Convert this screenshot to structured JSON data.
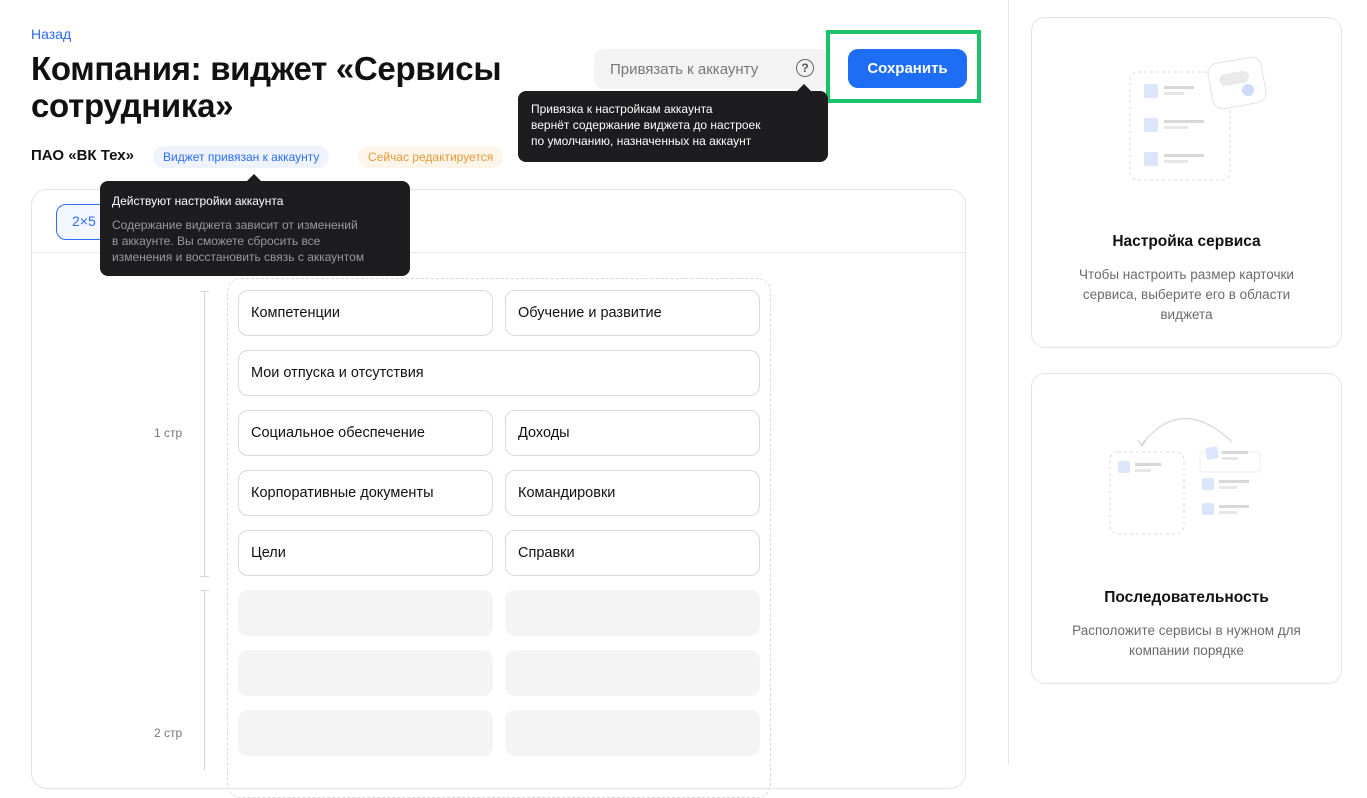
{
  "header": {
    "back_label": "Назад",
    "title": "Компания: виджет «Сервисы сотрудника»",
    "bind_button_label": "Привязать к аккаунту",
    "save_button_label": "Сохранить"
  },
  "company": {
    "name": "ПАО «ВК Тех»",
    "badge_linked": "Виджет привязан к аккаунту",
    "badge_editing": "Сейчас редактируется"
  },
  "tooltip_bind": {
    "lines": [
      "Привязка к настройкам аккаунта",
      "вернёт содержание виджета до настроек",
      "по умолчанию, назначенных на аккаунт"
    ]
  },
  "tooltip_account": {
    "title": "Действуют настройки аккаунта",
    "lines": [
      "Содержание виджета зависит от изменений",
      "в аккаунте. Вы сможете сбросить все",
      "изменения и восстановить связь с аккаунтом"
    ]
  },
  "layout": {
    "size_label": "2×5",
    "page1_label": "1 стр",
    "page2_label": "2 стр"
  },
  "tiles": [
    "Компетенции",
    "Обучение и развитие",
    "Мои отпуска и отсутствия",
    "Социальное обеспечение",
    "Доходы",
    "Корпоративные документы",
    "Командировки",
    "Цели",
    "Справки"
  ],
  "side_cards": {
    "service_setup": {
      "title": "Настройка сервиса",
      "text": "Чтобы настроить размер карточки сервиса, выберите его в области виджета"
    },
    "sequence": {
      "title": "Последовательность",
      "text": "Расположите сервисы в нужном для компании порядке"
    }
  },
  "colors": {
    "accent": "#1e6ef5",
    "highlight_frame": "#18c36a",
    "badge_linked_text": "#2c6cf6",
    "badge_editing_text": "#e39a36",
    "tooltip_bg": "#1d1d1f"
  }
}
